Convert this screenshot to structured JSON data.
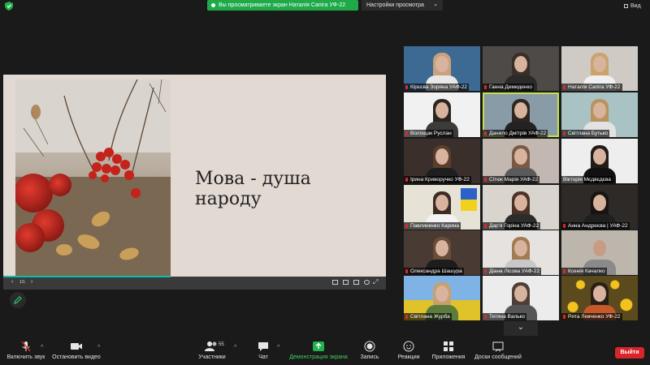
{
  "topbar": {
    "share_banner": "Вы просматриваете экран Наталія Сапіга УФ-22",
    "view_options": "Настройки просмотра",
    "view_options_caret": "⌄",
    "view_toggle": "Вид"
  },
  "slide": {
    "title": "Мова - душа народу",
    "counter": "1/1",
    "nav_prev": "‹",
    "nav_next": "›"
  },
  "participants": [
    {
      "name": "Кірєєва Зоряна УАФ-22",
      "muted": true
    },
    {
      "name": "Ганна Демиденко",
      "muted": true
    },
    {
      "name": "Наталія Сапіга УФ-22",
      "muted": true
    },
    {
      "name": "Волощак Руслан",
      "muted": true
    },
    {
      "name": "Данило Дмітрів УАФ-22",
      "muted": true
    },
    {
      "name": "Світлана Бутько",
      "muted": true
    },
    {
      "name": "Ірина Криворучко УФ-22",
      "muted": true
    },
    {
      "name": "Сітюк Марія УАФ-22",
      "muted": true
    },
    {
      "name": "Вікторія Мєдвєдєва",
      "muted": false
    },
    {
      "name": "Павлиненко Карина",
      "muted": true
    },
    {
      "name": "Дар'я Горіна УАФ-22",
      "muted": true
    },
    {
      "name": "Анна Андреєва | УАФ-22",
      "muted": true
    },
    {
      "name": "Олександра Шашура",
      "muted": true
    },
    {
      "name": "Діана Лісова УАФ-22",
      "muted": true
    },
    {
      "name": "Ксенія Качалко",
      "muted": true
    },
    {
      "name": "Світлана Журба",
      "muted": true
    },
    {
      "name": "Тетяна Валько",
      "muted": true
    },
    {
      "name": "Рита Левченко УФ-22",
      "muted": true
    }
  ],
  "toolbar": {
    "unmute": "Включить звук",
    "stop_video": "Остановить видео",
    "participants": "Участники",
    "participants_count": "55",
    "chat": "Чат",
    "share_screen": "Демонстрация экрана",
    "record": "Запись",
    "reactions": "Реакции",
    "apps": "Приложения",
    "whiteboards": "Доски сообщений",
    "leave": "Выйти",
    "caret": "^",
    "gallery_down": "⌄"
  },
  "colors": {
    "share_green": "#1faa4a",
    "leave_red": "#d9252a",
    "active_speaker": "#c4e04d",
    "progress_teal": "#0fb9b1"
  }
}
